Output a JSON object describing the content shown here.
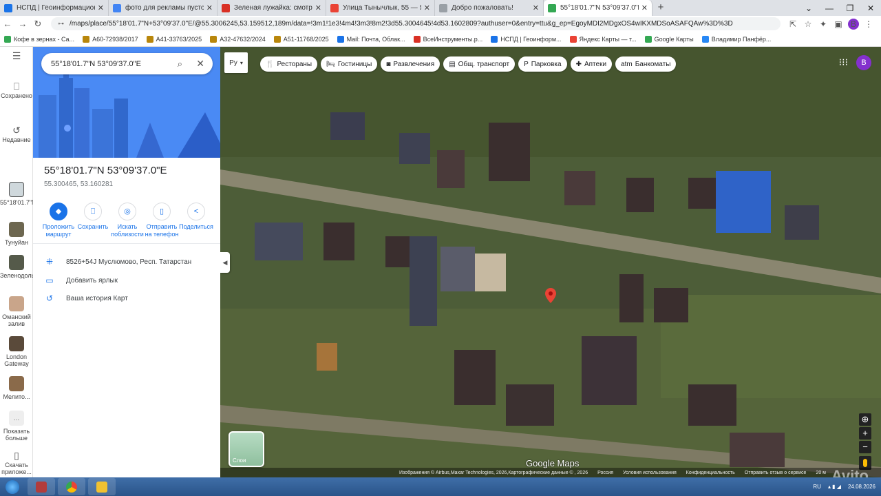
{
  "browser": {
    "tabs": [
      {
        "title": "НСПД | Геоинформационный п",
        "color": "#1a73e8",
        "active": false
      },
      {
        "title": "фото для рекламы пустого учас",
        "color": "#4285f4",
        "active": false
      },
      {
        "title": "Зеленая лужайка: смотрите и с",
        "color": "#d93025",
        "active": false
      },
      {
        "title": "Улица Тынычлык, 55 — Яндекс.",
        "color": "#ea4335",
        "active": false
      },
      {
        "title": "Добро пожаловать!",
        "color": "#9aa0a6",
        "active": false
      },
      {
        "title": "55°18'01.7\"N 53°09'37.0\"E – Goo",
        "color": "#34a853",
        "active": true
      }
    ],
    "new_tab": "+",
    "url": "/maps/place/55°18'01.7\"N+53°09'37.0\"E/@55.3006245,53.159512,189m/data=!3m1!1e3!4m4!3m3!8m2!3d55.3004645!4d53.1602809?authuser=0&entry=ttu&g_ep=EgoyMDI2MDgxOS4wIKXMDSoASAFQAw%3D%3D",
    "profile_initial": "B",
    "bookmarks": [
      {
        "label": "Кофе в зернах - Са...",
        "color": "#34a853"
      },
      {
        "label": "А60-72938/2017",
        "color": "#b8860b"
      },
      {
        "label": "А41-33763/2025",
        "color": "#b8860b"
      },
      {
        "label": "А32-47632/2024",
        "color": "#b8860b"
      },
      {
        "label": "А51-11768/2025",
        "color": "#b8860b"
      },
      {
        "label": "Mail: Почта, Облак...",
        "color": "#1a73e8"
      },
      {
        "label": "ВсеИнструменты.р...",
        "color": "#d93025"
      },
      {
        "label": "НСПД | Геоинформ...",
        "color": "#1a73e8"
      },
      {
        "label": "Яндекс Карты — т...",
        "color": "#ea4335"
      },
      {
        "label": "Google Карты",
        "color": "#34a853"
      },
      {
        "label": "Владимир Панфёр...",
        "color": "#2787f5"
      }
    ]
  },
  "sidebar": {
    "items": [
      {
        "label": "Сохранено",
        "icon": "bookmark-icon"
      },
      {
        "label": "Недавние",
        "icon": "history-icon"
      },
      {
        "label": "55°18'01.7\"N...",
        "icon": "thumbnail"
      },
      {
        "label": "Тунуйан",
        "icon": "thumbnail"
      },
      {
        "label": "Зеленодольский...",
        "icon": "thumbnail"
      },
      {
        "label": "Оманский залив",
        "icon": "thumbnail"
      },
      {
        "label": "London Gateway",
        "icon": "thumbnail"
      },
      {
        "label": "Мелито...",
        "icon": "thumbnail"
      },
      {
        "label": "Показать больше",
        "icon": "more-icon"
      },
      {
        "label": "Скачать приложе...",
        "icon": "phone-icon"
      }
    ]
  },
  "panel": {
    "search_value": "55°18'01.7\"N 53°09'37.0\"E",
    "title": "55°18'01.7\"N 53°09'37.0\"E",
    "coords": "55.300465, 53.160281",
    "actions": [
      {
        "label": "Проложить маршрут",
        "icon": "directions-icon",
        "primary": true
      },
      {
        "label": "Сохранить",
        "icon": "bookmark-icon",
        "primary": false
      },
      {
        "label": "Искать поблизости",
        "icon": "nearby-icon",
        "primary": false
      },
      {
        "label": "Отправить на телефон",
        "icon": "phone-icon",
        "primary": false
      },
      {
        "label": "Поделиться",
        "icon": "share-icon",
        "primary": false
      }
    ],
    "plus_code": "8526+54J Муслюмово, Респ. Татарстан",
    "add_label": "Добавить ярлык",
    "history": "Ваша история Карт"
  },
  "map": {
    "categories": [
      {
        "label": "Рестораны",
        "icon": "restaurant-icon"
      },
      {
        "label": "Гостиницы",
        "icon": "hotel-icon"
      },
      {
        "label": "Развлечения",
        "icon": "camera-icon"
      },
      {
        "label": "Общ. транспорт",
        "icon": "transit-icon"
      },
      {
        "label": "Парковка",
        "icon": "parking-icon"
      },
      {
        "label": "Аптеки",
        "icon": "pharmacy-icon"
      },
      {
        "label": "Банкоматы",
        "icon": "atm-icon"
      }
    ],
    "ruler_label": "Ру",
    "layers_label": "Слои",
    "watermark": "Google Maps",
    "credits": [
      "Изображения © Airbus,Maxar Technologies, 2026,Картографические данные © , 2026",
      "Россия",
      "Условия использования",
      "Конфиденциальность",
      "Отправить отзыв о сервисе",
      "20 м"
    ],
    "avito": "Avito",
    "zoom_in": "+",
    "zoom_out": "−"
  },
  "taskbar": {
    "lang": "RU",
    "time": "24.08.2026"
  }
}
